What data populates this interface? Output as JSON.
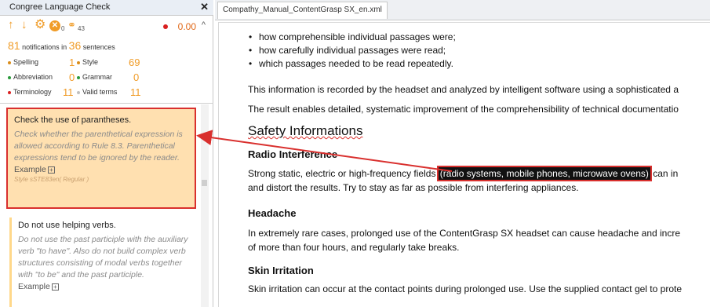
{
  "panel": {
    "title": "Congree Language Check",
    "close": "✕",
    "toolbar": {
      "up_icon": "↑",
      "down_icon": "↓",
      "gear_icon": "⚙",
      "error_icon": "✕",
      "error_count": "0",
      "chain_icon": "⚭",
      "chain_count": "43",
      "score": "0.00",
      "caret": "^"
    },
    "summary": {
      "notifications": "81",
      "notifications_label": "notifications in",
      "sentences": "36",
      "sentences_label": "sentences"
    },
    "stats": [
      {
        "label": "Spelling",
        "value": "1",
        "color": "#d98c1a"
      },
      {
        "label": "Style",
        "value": "69",
        "color": "#d98c1a"
      },
      {
        "label": "Abbreviation",
        "value": "0",
        "color": "#2a9a3a"
      },
      {
        "label": "Grammar",
        "value": "0",
        "color": "#2a9a3a"
      },
      {
        "label": "Terminology",
        "value": "11",
        "color": "#d92020"
      },
      {
        "label": "Valid terms",
        "value": "11",
        "color": "#c0c0c0"
      }
    ],
    "cards": [
      {
        "title": "Check the use of parantheses.",
        "description": "Check whether the parenthetical expression is allowed according to Rule 8.3. Parenthetical expressions tend to be ignored by the reader.",
        "example": "Example",
        "style": "Style sSTE83en( Regular )"
      },
      {
        "title": "Do not use helping verbs.",
        "description": "Do not use the past participle with the auxiliary verb \"to have\". Also do not build complex verb structures consisting of modal verbs together with \"to be\" and the past participle.",
        "example": "Example"
      }
    ]
  },
  "editor": {
    "tab": "Compathy_Manual_ContentGrasp SX_en.xml",
    "bullets": [
      "how comprehensible individual passages were;",
      "how carefully individual passages were read;",
      "which passages needed to be read repeatedly."
    ],
    "para1": "This information is recorded by the headset and analyzed by intelligent software using a sophisticated a",
    "para2": "The result enables detailed, systematic improvement of the comprehensibility of technical documentatio",
    "heading": "Safety Informations",
    "sections": [
      {
        "title": "Radio Interference",
        "line1_before": "Strong static, electric or high-frequency fields ",
        "line1_highlight": "(radio systems, mobile phones, microwave ovens)",
        "line1_after": " can in",
        "line2": "and distort the results. Try to stay as far as possible from interfering appliances."
      },
      {
        "title": "Headache",
        "line1": "In extremely rare cases, prolonged use of the ContentGrasp SX headset can cause headache and incre",
        "line2": "of more than four hours, and regularly take breaks."
      },
      {
        "title": "Skin Irritation",
        "line1": "Skin irritation can occur at the contact points during prolonged use. Use the supplied contact gel to prote"
      }
    ]
  }
}
